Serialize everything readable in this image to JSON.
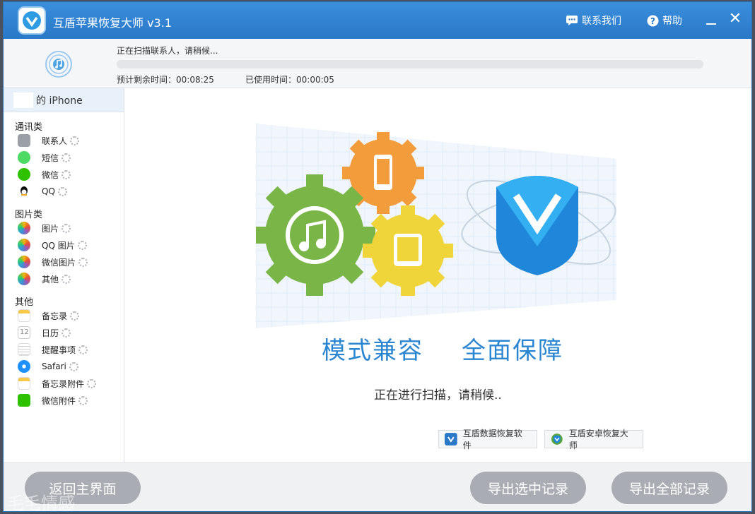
{
  "app": {
    "title": "互盾苹果恢复大师 v3.1",
    "contact_label": "联系我们",
    "help_label": "帮助",
    "accent": "#2a78c8"
  },
  "progress": {
    "status": "正在扫描联系人，请稍候...",
    "fraction": 0.0,
    "remaining": "预计剩余时间：00:08:25",
    "used": "已使用时间：00:00:05"
  },
  "sidebar": {
    "device": "的 iPhone",
    "groups": [
      {
        "label": "通讯类",
        "items": [
          {
            "label": "联系人",
            "icon": "contacts-icon"
          },
          {
            "label": "短信",
            "icon": "messages-icon"
          },
          {
            "label": "微信",
            "icon": "wechat-icon"
          },
          {
            "label": "QQ",
            "icon": "qq-icon"
          }
        ]
      },
      {
        "label": "图片类",
        "items": [
          {
            "label": "图片",
            "icon": "photos-icon"
          },
          {
            "label": "QQ 图片",
            "icon": "qq-photos-icon"
          },
          {
            "label": "微信图片",
            "icon": "wechat-photos-icon"
          },
          {
            "label": "其他",
            "icon": "other-photos-icon"
          }
        ]
      },
      {
        "label": "其他",
        "items": [
          {
            "label": "备忘录",
            "icon": "notes-icon"
          },
          {
            "label": "日历",
            "icon": "calendar-icon"
          },
          {
            "label": "提醒事项",
            "icon": "reminders-icon"
          },
          {
            "label": "Safari",
            "icon": "safari-icon"
          },
          {
            "label": "备忘录附件",
            "icon": "notes-attachment-icon"
          },
          {
            "label": "微信附件",
            "icon": "wechat-attachment-icon"
          }
        ]
      }
    ],
    "calendar_day": "12"
  },
  "main": {
    "slogan_left": "模式兼容",
    "slogan_right": "全面保障",
    "scanning_text": "正在进行扫描，请稍候..",
    "promo1": "互盾数据恢复软件",
    "promo2": "互盾安卓恢复大师"
  },
  "footer": {
    "back": "返回主界面",
    "export_selected": "导出选中记录",
    "export_all": "导出全部记录",
    "watermark": "毛毛情感"
  }
}
